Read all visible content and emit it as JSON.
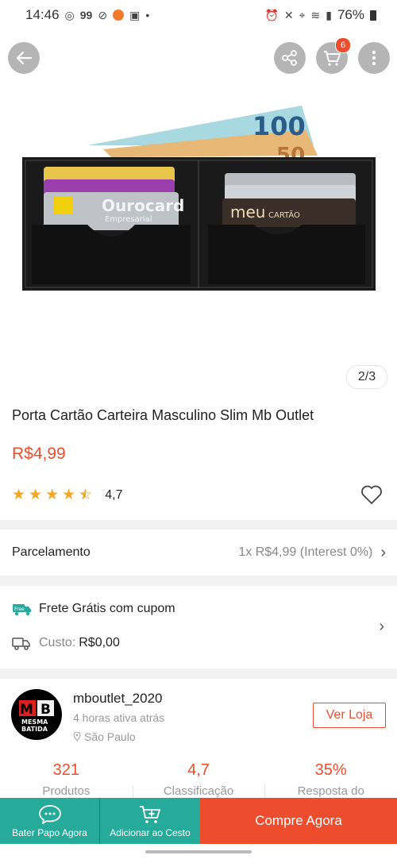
{
  "status_bar": {
    "time": "14:46",
    "battery": "76%"
  },
  "header": {
    "cart_count": "6"
  },
  "gallery": {
    "pager": "2/3",
    "image_text": {
      "note_100": "100",
      "note_50": "50",
      "card_brand": "Ourocard",
      "card_sub": "Empresarial",
      "card2_brand": "meu",
      "card2_sub": "CARTÃO"
    }
  },
  "product": {
    "title": "Porta Cartão Carteira Masculino Slim Mb Outlet",
    "price": "R$4,99",
    "rating": "4,7",
    "stars": 4.5
  },
  "installments": {
    "label": "Parcelamento",
    "value": "1x R$4,99 (Interest 0%)"
  },
  "shipping": {
    "free_tag": "Free",
    "free_text": "Frete Grátis com cupom",
    "cost_label": "Custo:",
    "cost_value": "R$0,00"
  },
  "shop": {
    "logo_text": "MB",
    "logo_sub": "MESMA BATIDA",
    "name": "mboutlet_2020",
    "active": "4 horas ativa atrás",
    "location": "São Paulo",
    "visit_button": "Ver Loja",
    "stats": [
      {
        "value": "321",
        "caption": "Produtos"
      },
      {
        "value": "4,7",
        "caption": "Classificação"
      },
      {
        "value": "35%",
        "caption": "Resposta do"
      }
    ]
  },
  "bottom_bar": {
    "chat_label": "Bater Papo Agora",
    "cart_label": "Adicionar ao Cesto",
    "buy_label": "Compre Agora"
  },
  "colors": {
    "accent": "#ee4d2d",
    "teal": "#26aa99",
    "star": "#f5a623"
  }
}
